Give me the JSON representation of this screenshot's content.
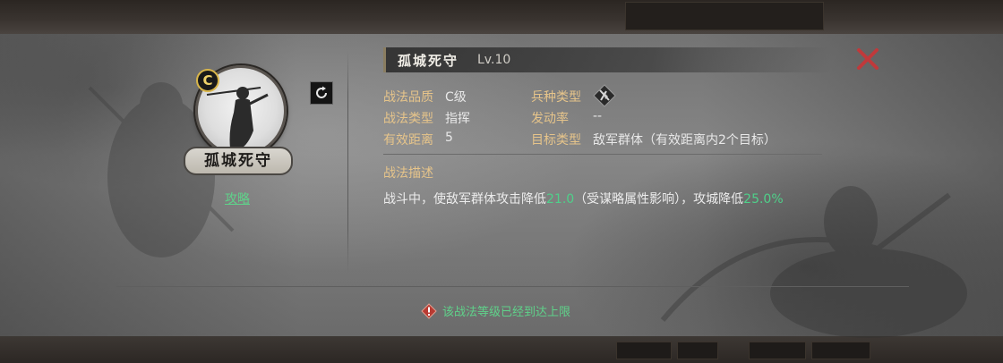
{
  "skill": {
    "grade_badge": "C",
    "name": "孤城死守",
    "name_plate": "孤城死守",
    "level": "Lv.10",
    "strategy_link": "攻略"
  },
  "attributes": [
    {
      "label": "战法品质",
      "value": "C级"
    },
    {
      "label": "兵种类型",
      "value": ""
    },
    {
      "label": "战法类型",
      "value": "指挥"
    },
    {
      "label": "发动率",
      "value": "--"
    },
    {
      "label": "有效距离",
      "value": "5"
    },
    {
      "label": "目标类型",
      "value": "敌军群体（有效距离内2个目标）"
    }
  ],
  "description": {
    "heading": "战法描述",
    "part1": "战斗中，使敌军群体攻击降低",
    "value1": "21.0",
    "part2": "（受谋略属性影响），攻城降低",
    "value2": "25.0%"
  },
  "warning": {
    "text": "该战法等级已经到达上限"
  },
  "icons": {
    "refresh": "refresh-icon",
    "close": "close-icon",
    "troop": "troop-type-icon",
    "warning": "warning-icon"
  },
  "colors": {
    "highlight": "#4fd08a",
    "label": "#e6c48a",
    "close": "#c0393b"
  }
}
